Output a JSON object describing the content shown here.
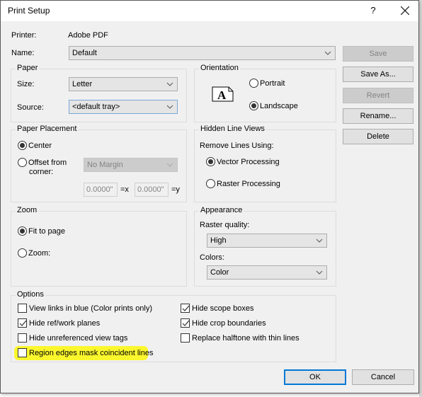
{
  "window": {
    "title": "Print Setup",
    "help_label": "?",
    "close_icon": "close-icon"
  },
  "printer": {
    "label": "Printer:",
    "value": "Adobe PDF"
  },
  "name": {
    "label": "Name:",
    "value": "Default"
  },
  "side_buttons": {
    "save": "Save",
    "save_as": "Save As...",
    "revert": "Revert",
    "rename": "Rename...",
    "delete": "Delete"
  },
  "paper": {
    "title": "Paper",
    "size_label": "Size:",
    "size_value": "Letter",
    "source_label": "Source:",
    "source_value": "<default tray>"
  },
  "orientation": {
    "title": "Orientation",
    "icon_letter": "A",
    "portrait": "Portrait",
    "landscape": "Landscape",
    "selected": "landscape"
  },
  "paper_placement": {
    "title": "Paper Placement",
    "center": "Center",
    "offset_line1": "Offset from",
    "offset_line2": "corner:",
    "margin_value": "No Margin",
    "x_value": "0.0000\"",
    "x_label": "=x",
    "y_value": "0.0000\"",
    "y_label": "=y",
    "selected": "center"
  },
  "hidden_line": {
    "title": "Hidden Line Views",
    "remove_label": "Remove Lines Using:",
    "vector": "Vector Processing",
    "raster": "Raster Processing",
    "selected": "vector"
  },
  "zoom": {
    "title": "Zoom",
    "fit": "Fit to page",
    "zoom": "Zoom:",
    "selected": "fit"
  },
  "appearance": {
    "title": "Appearance",
    "raster_label": "Raster quality:",
    "raster_value": "High",
    "colors_label": "Colors:",
    "colors_value": "Color"
  },
  "options": {
    "title": "Options",
    "items": [
      {
        "label": "View links in blue (Color prints only)",
        "checked": false
      },
      {
        "label": "Hide ref/work planes",
        "checked": true
      },
      {
        "label": "Hide unreferenced view tags",
        "checked": false
      },
      {
        "label": "Region edges mask coincident lines",
        "checked": false,
        "highlighted": true
      },
      {
        "label": "Hide scope boxes",
        "checked": true
      },
      {
        "label": "Hide crop boundaries",
        "checked": true
      },
      {
        "label": "Replace halftone with thin lines",
        "checked": false
      }
    ],
    "highlight_color": "#fbf72d"
  },
  "footer": {
    "ok": "OK",
    "cancel": "Cancel"
  },
  "colors": {
    "accent": "#0078d7",
    "dialog_bg": "#f0f0f0",
    "disabled_text": "#838383"
  }
}
